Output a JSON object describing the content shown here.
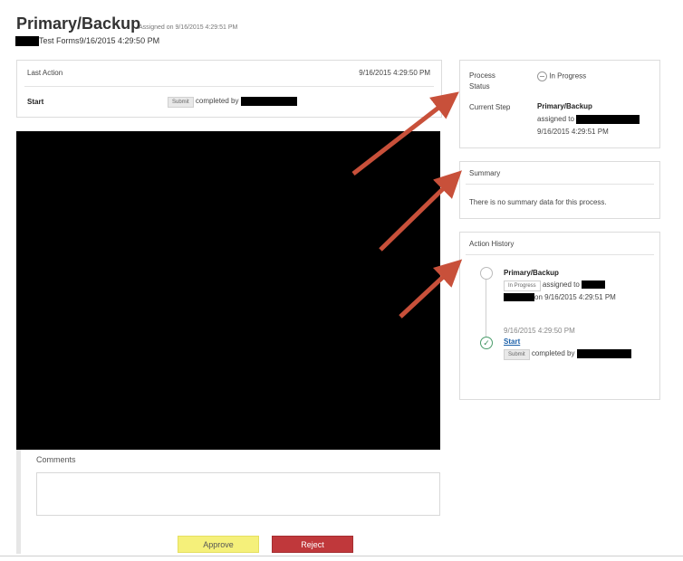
{
  "header": {
    "title": "Primary/Backup",
    "assigned_on": "Assigned on 9/16/2015 4:29:51 PM",
    "subtitle": "Test Forms9/16/2015 4:29:50 PM"
  },
  "last_action": {
    "label": "Last Action",
    "timestamp": "9/16/2015 4:29:50 PM",
    "step": "Start",
    "tag": "Submit",
    "text": "completed by"
  },
  "process": {
    "status_label": "Process Status",
    "status_value": "In Progress",
    "current_step_label": "Current Step",
    "current_step_name": "Primary/Backup",
    "assigned_text": "assigned to",
    "assigned_time": "9/16/2015 4:29:51 PM"
  },
  "summary": {
    "title": "Summary",
    "text": "There is no summary data for this process."
  },
  "history": {
    "title": "Action History",
    "items": [
      {
        "name": "Primary/Backup",
        "tag": "In Progress",
        "text": "assigned to",
        "time_text": "on 9/16/2015 4:29:51 PM"
      },
      {
        "time": "9/16/2015 4:29:50 PM",
        "name": "Start",
        "tag": "Submit",
        "text": "completed by"
      }
    ]
  },
  "comments": {
    "label": "Comments",
    "placeholder": ""
  },
  "buttons": {
    "approve": "Approve",
    "reject": "Reject"
  },
  "colors": {
    "arrow": "#c8503a",
    "approve": "#f5f07a",
    "reject": "#c0383b"
  }
}
